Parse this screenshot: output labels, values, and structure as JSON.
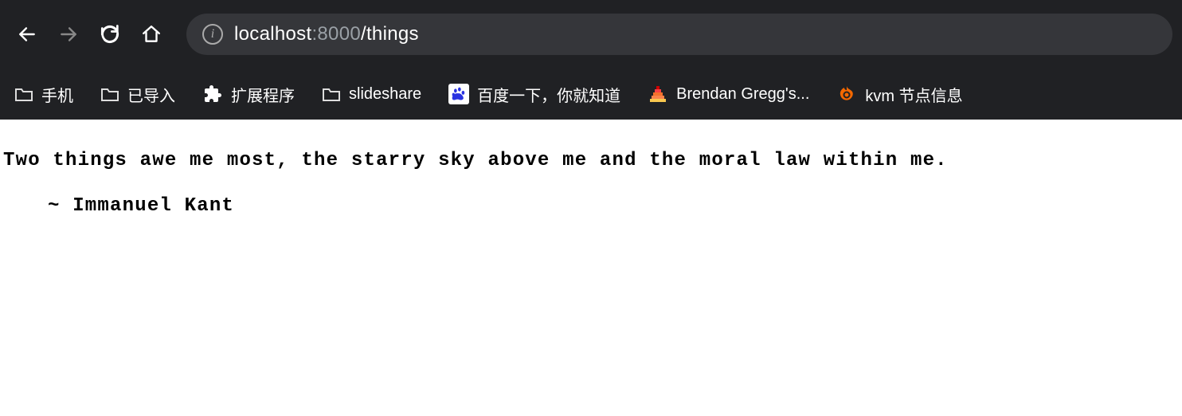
{
  "url": {
    "host": "localhost",
    "port": ":8000",
    "path": "/things"
  },
  "bookmarks": {
    "item0": "手机",
    "item1": "已导入",
    "item2": "扩展程序",
    "item3": "slideshare",
    "item4": "百度一下，你就知道",
    "item5": "Brendan Gregg's...",
    "item6": "kvm 节点信息"
  },
  "page": {
    "quote": "Two things awe me most, the starry sky above me and the moral law within me.",
    "attribution": "~ Immanuel Kant"
  }
}
